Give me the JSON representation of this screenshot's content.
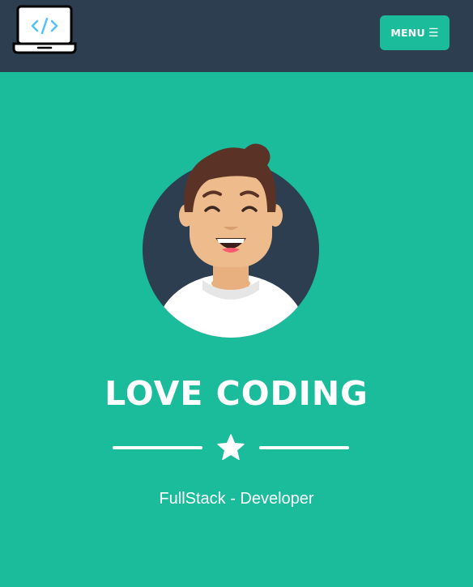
{
  "navbar": {
    "logo_icon": "laptop-code-icon",
    "menu_label": "MENU",
    "menu_icon": "hamburger-icon",
    "menu_glyph": "☰"
  },
  "masthead": {
    "avatar_icon": "developer-avatar",
    "title": "LOVE CODING",
    "divider_icon": "star-icon",
    "subtitle": "FullStack - Developer"
  },
  "colors": {
    "primary": "#1abc9c",
    "navbar": "#2c3e50",
    "text": "#ffffff"
  }
}
